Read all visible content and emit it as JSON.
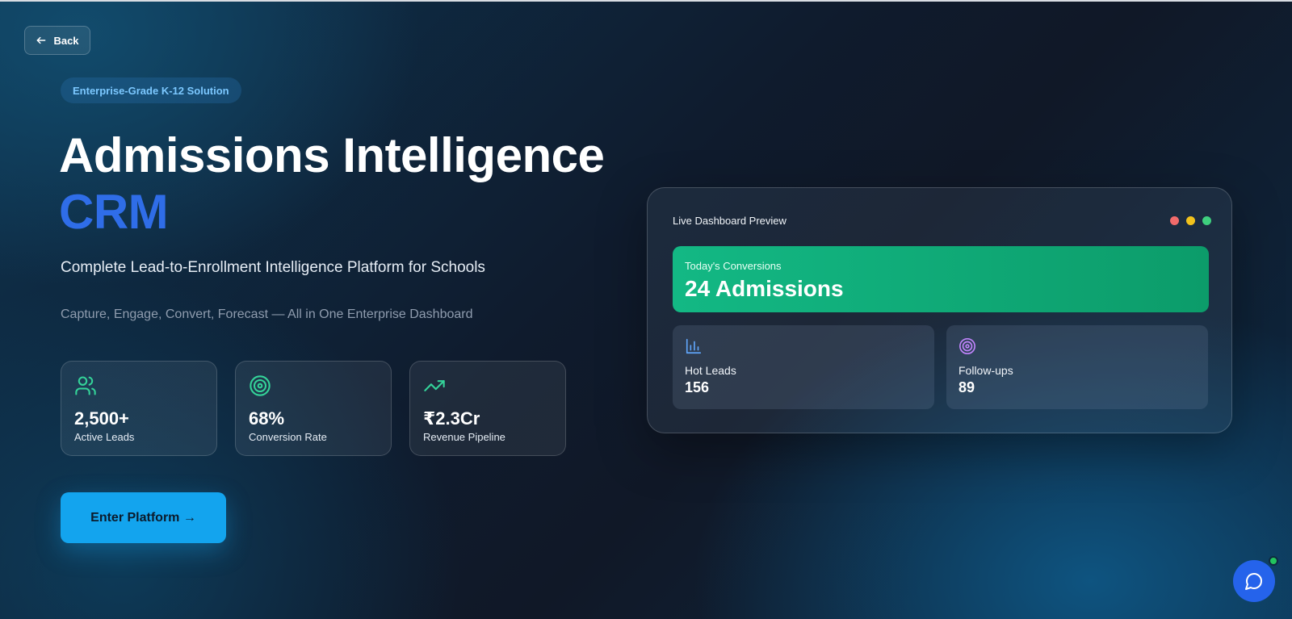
{
  "back_button": {
    "label": "Back",
    "icon": "arrow-left-icon"
  },
  "hero": {
    "badge": "Enterprise-Grade K-12 Solution",
    "title_line1": "Admissions Intelligence",
    "title_line2": "CRM",
    "subtitle": "Complete Lead-to-Enrollment Intelligence Platform for Schools",
    "tagline": "Capture, Engage, Convert, Forecast — All in One Enterprise Dashboard"
  },
  "stats": [
    {
      "value": "2,500+",
      "label": "Active Leads",
      "icon": "users-icon"
    },
    {
      "value": "68%",
      "label": "Conversion Rate",
      "icon": "target-icon"
    },
    {
      "value": "₹2.3Cr",
      "label": "Revenue Pipeline",
      "icon": "trending-up-icon"
    }
  ],
  "cta": {
    "label": "Enter Platform →"
  },
  "dashboard": {
    "title": "Live Dashboard Preview",
    "conversions": {
      "label": "Today's Conversions",
      "value": "24 Admissions"
    },
    "hot_leads": {
      "label": "Hot Leads",
      "value": "156",
      "icon": "bar-chart-icon"
    },
    "follow_ups": {
      "label": "Follow-ups",
      "value": "89",
      "icon": "target-icon"
    }
  },
  "colors": {
    "accent_blue": "#2f6de8",
    "cta": "#13a4ee",
    "success": "#13b884",
    "stat_icon": "#34d399",
    "hot_leads_icon": "#60a5fa",
    "follow_ups_icon": "#c084fc",
    "window_red": "#f26b6b",
    "window_yellow": "#f2c21c",
    "window_green": "#3fcf7e"
  },
  "chat": {
    "icon": "message-circle-icon"
  }
}
